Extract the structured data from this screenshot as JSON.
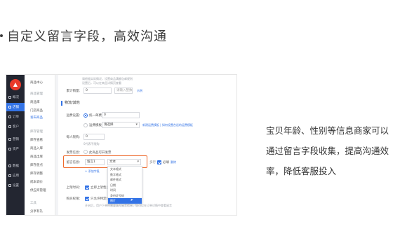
{
  "headline": "自定义留言字段，高效沟通",
  "description_lines": [
    "宝贝年龄、性别等信息商家可以",
    "通过留言字段收集，提高沟通效",
    "率，降低客服投入"
  ],
  "app": {
    "logo_icon": "app-logo",
    "nav": [
      {
        "label": "概况",
        "icon": "dashboard-icon",
        "active": false
      },
      {
        "label": "店铺",
        "icon": "store-icon",
        "active": true
      },
      {
        "label": "订单",
        "icon": "order-icon",
        "active": false
      },
      {
        "label": "客户",
        "icon": "customer-icon",
        "active": false
      },
      {
        "label": "营销",
        "icon": "marketing-icon",
        "active": false
      },
      {
        "label": "资产",
        "icon": "asset-icon",
        "active": false
      },
      {
        "label": "数据",
        "icon": "data-icon",
        "active": false
      },
      {
        "label": "应用",
        "icon": "app-icon",
        "active": false
      },
      {
        "label": "设置",
        "icon": "settings-icon",
        "active": false
      }
    ],
    "subnav": [
      {
        "label": "商品中心",
        "group": false,
        "active": false
      },
      {
        "label": "商品管理",
        "group": true,
        "active": false
      },
      {
        "label": "商品库",
        "group": false,
        "active": false
      },
      {
        "label": "门店商品",
        "group": false,
        "active": false
      },
      {
        "label": "发布商品",
        "group": false,
        "active": true
      },
      {
        "label": "库存管理",
        "group": true,
        "active": false
      },
      {
        "label": "库存查看",
        "group": false,
        "active": false
      },
      {
        "label": "商品入库",
        "group": false,
        "active": false
      },
      {
        "label": "商品出库",
        "group": false,
        "active": false
      },
      {
        "label": "库存盘点",
        "group": false,
        "active": false
      },
      {
        "label": "库存调整",
        "group": false,
        "active": false
      },
      {
        "label": "成本调价",
        "group": false,
        "active": false
      },
      {
        "label": "供应商管理",
        "group": false,
        "active": false
      },
      {
        "label": "工具",
        "group": true,
        "active": false
      },
      {
        "label": "分享有礼",
        "group": false,
        "active": false
      }
    ],
    "form": {
      "top_hint_1": "请根据实际情况，设置商品满额包邮规则",
      "top_hint_2": "设置后，可以在商品详情页查看",
      "sales_label": "累计销量：",
      "sales_value": "0",
      "sales_unit_hint": "请输入整数",
      "sales_link": "示例",
      "section_title": "物流/其他",
      "shipping_label": "运费设置：",
      "shipping_flat": "统一邮费",
      "shipping_flat_value": "0",
      "shipping_template": "运费模板",
      "shipping_template_value": "请选择",
      "shipping_template_link": "新建运费模板 | 如何设置合适的运费模板",
      "limit_label": "每人限购：",
      "limit_value": "0",
      "limit_hint": "0代表不限购",
      "invoice_label": "发票信息：",
      "invoice_text": "此商品可开发票",
      "message_label": "留言信息：",
      "message_name_value": "留言1",
      "message_type_value": "文本",
      "required_text": "必填",
      "delete_link": "删除",
      "add_message_link": "+ 添加字段",
      "onsale_label": "上架时间：",
      "onsale_text": "立即上架售卖",
      "buy_label": "购买权限：",
      "buy_text": "只允许特定会员购买",
      "bottom_hint": "开启后，用户下单时需要填写留言信息，您可以在订单详情中查看留言"
    },
    "dropdown_options": [
      "文本格式",
      "数字格式",
      "邮件格式",
      "日期",
      "时间",
      "身份证号码",
      "图片"
    ],
    "dropdown_selected_index": 6,
    "highlight_color": "#ee6a2c",
    "accent_color": "#3373e6"
  }
}
